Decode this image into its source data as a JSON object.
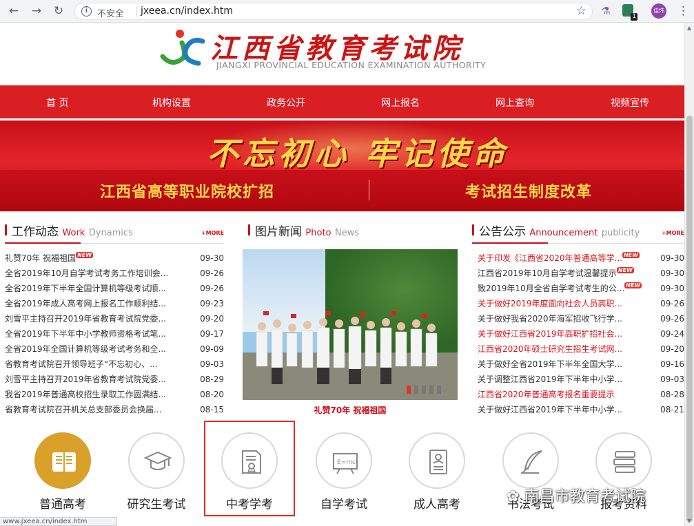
{
  "browser": {
    "security": "不安全",
    "url": "jxeea.cn/index.htm",
    "avatar_text": "佳炜",
    "ext_badge": "1",
    "status_url": "www.jxeea.cn/index.htm"
  },
  "site": {
    "title": "江西省教育考试院",
    "subtitle": "JIANGXI PROVINCIAL EDUCATION EXAMINATION AUTHORITY"
  },
  "nav": [
    "首 页",
    "机构设置",
    "政务公开",
    "网上报名",
    "网上查询",
    "视频宣传"
  ],
  "banner": {
    "slogan": "不忘初心 牢记使命",
    "left": "江西省高等职业院校扩招",
    "right": "考试招生制度改革"
  },
  "work": {
    "title": "工作动态",
    "en1": "Work",
    "en2": "Dynamics",
    "more": "+MORE",
    "items": [
      {
        "t": "礼赞70年 祝福祖国",
        "d": "09-30",
        "new": true
      },
      {
        "t": "全省2019年10月自学考试考务工作培训会...",
        "d": "09-26"
      },
      {
        "t": "全省2019年下半年全国计算机等级考试顺...",
        "d": "09-26"
      },
      {
        "t": "全省2019年成人高考网上报名工作顺利结...",
        "d": "09-23"
      },
      {
        "t": "刘雪平主持召开2019年省教育考试院党委...",
        "d": "09-20"
      },
      {
        "t": "全省2019年下半年中小学教师资格考试笔...",
        "d": "09-17"
      },
      {
        "t": "全省2019年全国计算机等级考试考务和全...",
        "d": "09-09"
      },
      {
        "t": "省教育考试院召开领导班子“不忘初心、...",
        "d": "09-03"
      },
      {
        "t": "刘雪平主持召开2019年省教育考试院党委...",
        "d": "08-29"
      },
      {
        "t": "我省2019年普通高校招生录取工作圆满结...",
        "d": "08-20"
      },
      {
        "t": "省教育考试院召开机关总支部委员会换届...",
        "d": "08-15"
      }
    ]
  },
  "photo": {
    "title": "图片新闻",
    "en1": "Photo",
    "en2": "News",
    "caption": "礼赞70年 祝福祖国"
  },
  "notice": {
    "title": "公告公示",
    "en1": "Announcement",
    "en2": "publicity",
    "more": "+MORE",
    "items": [
      {
        "t": "关于印发《江西省2020年普通高等学...",
        "d": "09-30",
        "new": true,
        "red": true
      },
      {
        "t": "江西省2019年10月自学考试温馨提示",
        "d": "09-30",
        "new": true
      },
      {
        "t": "致2019年10月全省自学考试考生的公...",
        "d": "09-30",
        "new": true
      },
      {
        "t": "关于做好2019年度面向社会人员高职...",
        "d": "09-26",
        "red": true
      },
      {
        "t": "关于做好我省2020年海军招收飞行学...",
        "d": "09-26"
      },
      {
        "t": "关于做好江西省2019年高职扩招社会...",
        "d": "09-24",
        "red": true
      },
      {
        "t": "江西省2020年硕士研究生招生考试网...",
        "d": "09-20",
        "red": true
      },
      {
        "t": "关于做好全省2019年下半年全国大学...",
        "d": "09-16"
      },
      {
        "t": "关于调整江西省2019年下半年中小学...",
        "d": "09-03"
      },
      {
        "t": "江西省2020年普通高考报名重要提示",
        "d": "08-28",
        "red": true
      },
      {
        "t": "关于做好江西省2019年下半年中小学...",
        "d": "08-21"
      }
    ]
  },
  "new_label": "NEW",
  "quick": [
    {
      "label": "普通高考",
      "icon": "book-icon"
    },
    {
      "label": "研究生考试",
      "icon": "graduation-cap-icon"
    },
    {
      "label": "中考学考",
      "icon": "certificate-icon"
    },
    {
      "label": "自学考试",
      "icon": "blackboard-icon"
    },
    {
      "label": "成人高考",
      "icon": "id-card-icon"
    },
    {
      "label": "书法考试",
      "icon": "quill-icon"
    },
    {
      "label": "报考资料",
      "icon": "books-icon"
    }
  ],
  "watermark": "南昌市教育考试院",
  "colors": {
    "brand_red": "#d91e24",
    "gold": "#ffd84a",
    "highlight": "#e32b25"
  }
}
